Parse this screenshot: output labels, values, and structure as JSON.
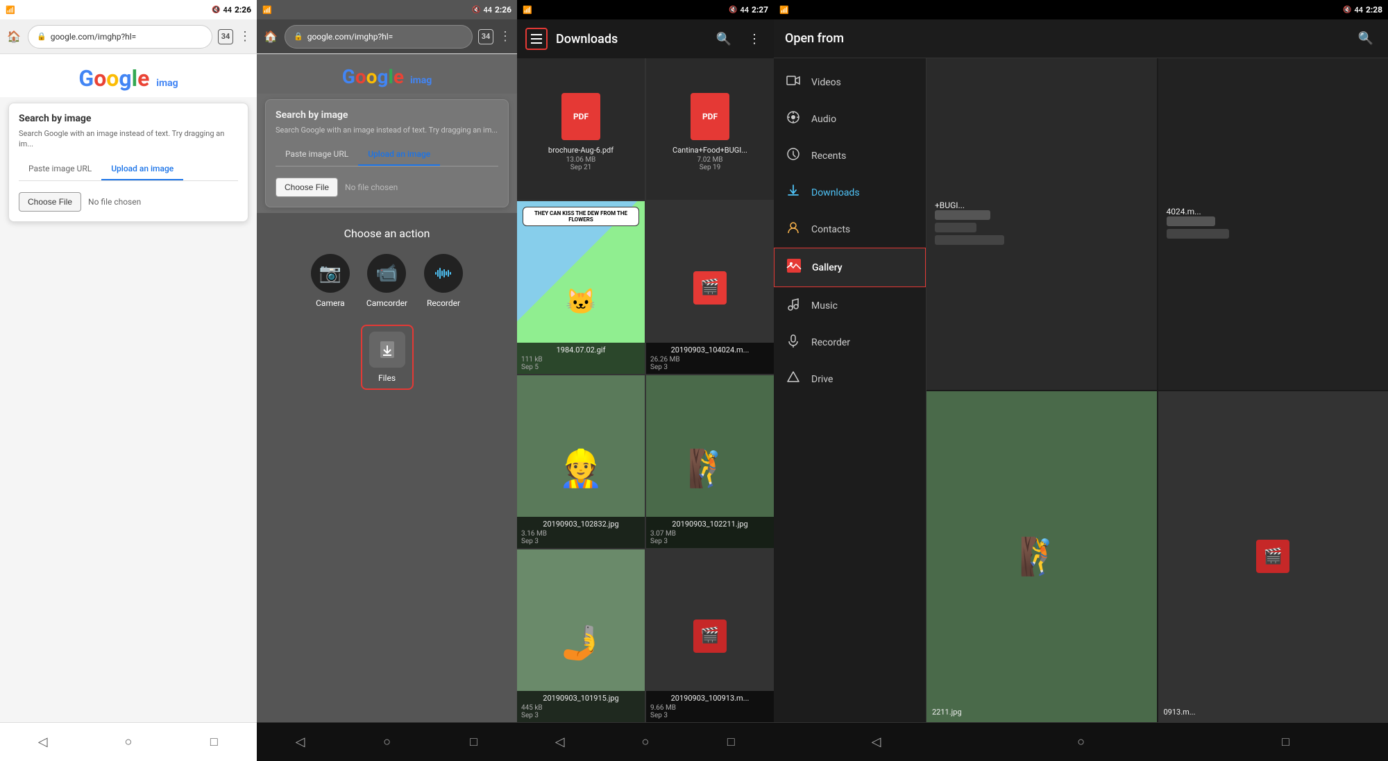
{
  "panel1": {
    "status": {
      "time": "2:26",
      "battery": "44"
    },
    "addressBar": {
      "url": "google.com/imghp?hl=",
      "tabCount": "34"
    },
    "googleLogo": "Google",
    "dialog": {
      "title": "Search by image",
      "description": "Search Google with an image instead of text. Try dragging an im...",
      "tabs": [
        "Paste image URL",
        "Upload an image"
      ],
      "activeTab": "Upload an image",
      "chooseFileBtn": "Choose File",
      "noFileText": "No file chosen"
    },
    "nav": {
      "back": "◁",
      "home": "○",
      "recent": "□"
    }
  },
  "panel2": {
    "status": {
      "time": "2:26",
      "battery": "44"
    },
    "addressBar": {
      "url": "google.com/imghp?hl=",
      "tabCount": "34"
    },
    "dialog": {
      "title": "Search by image",
      "description": "Search Google with an image instead of text. Try dragging an im...",
      "tabs": [
        "Paste image URL",
        "Upload an image"
      ],
      "activeTab": "Upload an image",
      "chooseFileBtn": "Choose File",
      "noFileText": "No file chosen"
    },
    "actionSection": {
      "title": "Choose an action",
      "items": [
        {
          "label": "Camera",
          "icon": "📷"
        },
        {
          "label": "Camcorder",
          "icon": "📹"
        },
        {
          "label": "Recorder",
          "icon": "🎙️"
        }
      ],
      "filesLabel": "Files"
    },
    "nav": {
      "back": "◁",
      "home": "○",
      "recent": "□"
    }
  },
  "panel3": {
    "status": {
      "time": "2:27",
      "battery": "44"
    },
    "header": {
      "title": "Downloads",
      "searchIcon": "🔍",
      "moreIcon": "⋮"
    },
    "files": [
      {
        "name": "brochure-Aug-6.pdf",
        "size": "13.06 MB",
        "date": "Sep 21",
        "type": "pdf"
      },
      {
        "name": "Cantina+Food+BUGI...",
        "size": "7.02 MB",
        "date": "Sep 19",
        "type": "pdf"
      },
      {
        "name": "1984.07.02.gif",
        "size": "111 kB",
        "date": "Sep 5",
        "type": "gif",
        "caption": "THEY CAN KISS THE DEW FROM THE FLOWERS"
      },
      {
        "name": "20190903_104024.m...",
        "size": "26.26 MB",
        "date": "Sep 3",
        "type": "video"
      },
      {
        "name": "20190903_102832.jpg",
        "size": "3.16 MB",
        "date": "Sep 3",
        "type": "photo"
      },
      {
        "name": "20190903_102211.jpg",
        "size": "3.07 MB",
        "date": "Sep 3",
        "type": "photo"
      },
      {
        "name": "20190903_101915.jpg",
        "size": "445 kB",
        "date": "Sep 3",
        "type": "selfie"
      },
      {
        "name": "20190903_100913.m...",
        "size": "9.66 MB",
        "date": "Sep 3",
        "type": "video2"
      }
    ],
    "nav": {
      "back": "◁",
      "home": "○",
      "recent": "□"
    }
  },
  "panel4": {
    "status": {
      "time": "2:28",
      "battery": "44"
    },
    "header": {
      "title": "Open from",
      "searchIcon": "🔍"
    },
    "sidebarItems": [
      {
        "label": "Videos",
        "icon": "🎬",
        "iconName": "video-icon"
      },
      {
        "label": "Audio",
        "icon": "🎵",
        "iconName": "audio-icon"
      },
      {
        "label": "Recents",
        "icon": "🕐",
        "iconName": "recents-icon"
      },
      {
        "label": "Downloads",
        "icon": "⬇",
        "iconName": "downloads-icon",
        "active": true,
        "blue": true
      },
      {
        "label": "Contacts",
        "icon": "👤",
        "iconName": "contacts-icon",
        "yellow": true
      },
      {
        "label": "Gallery",
        "icon": "🖼",
        "iconName": "gallery-icon",
        "activeGallery": true,
        "red": true
      },
      {
        "label": "Music",
        "icon": "🎵",
        "iconName": "music-icon"
      },
      {
        "label": "Recorder",
        "icon": "🎙",
        "iconName": "recorder-icon"
      },
      {
        "label": "Drive",
        "icon": "△",
        "iconName": "drive-icon"
      }
    ],
    "rightFiles": [
      {
        "name": "+BUGI...",
        "type": "text",
        "side": "right"
      },
      {
        "name": "4024.m...",
        "type": "blur"
      },
      {
        "name": "2211.jpg",
        "type": "photo-partial"
      },
      {
        "name": "0913.m...",
        "type": "blur2"
      }
    ],
    "nav": {
      "back": "◁",
      "home": "○",
      "recent": "□"
    }
  }
}
